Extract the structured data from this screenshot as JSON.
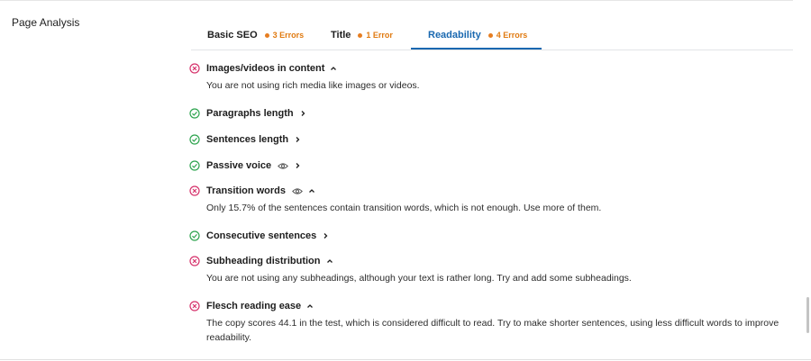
{
  "section_label": "Page Analysis",
  "colors": {
    "error": "#d6336c",
    "good": "#2ea44f",
    "warning_dot": "#e67e22",
    "active_tab": "#1968b0"
  },
  "tabs": [
    {
      "label": "Basic SEO",
      "count": "3 Errors",
      "active": false
    },
    {
      "label": "Title",
      "count": "1 Error",
      "active": false
    },
    {
      "label": "Readability",
      "count": "4 Errors",
      "active": true
    }
  ],
  "checks": [
    {
      "title": "Images/videos in content",
      "status": "error",
      "expanded": true,
      "eye": false,
      "description": "You are not using rich media like images or videos."
    },
    {
      "title": "Paragraphs length",
      "status": "good",
      "expanded": false,
      "eye": false
    },
    {
      "title": "Sentences length",
      "status": "good",
      "expanded": false,
      "eye": false
    },
    {
      "title": "Passive voice",
      "status": "good",
      "expanded": false,
      "eye": true
    },
    {
      "title": "Transition words",
      "status": "error",
      "expanded": true,
      "eye": true,
      "description": "Only 15.7% of the sentences contain transition words, which is not enough. Use more of them."
    },
    {
      "title": "Consecutive sentences",
      "status": "good",
      "expanded": false,
      "eye": false
    },
    {
      "title": "Subheading distribution",
      "status": "error",
      "expanded": true,
      "eye": false,
      "description": "You are not using any subheadings, although your text is rather long. Try and add some subheadings."
    },
    {
      "title": "Flesch reading ease",
      "status": "error",
      "expanded": true,
      "eye": false,
      "description": "The copy scores 44.1 in the test, which is considered difficult to read. Try to make shorter sentences, using less difficult words to improve readability."
    }
  ]
}
